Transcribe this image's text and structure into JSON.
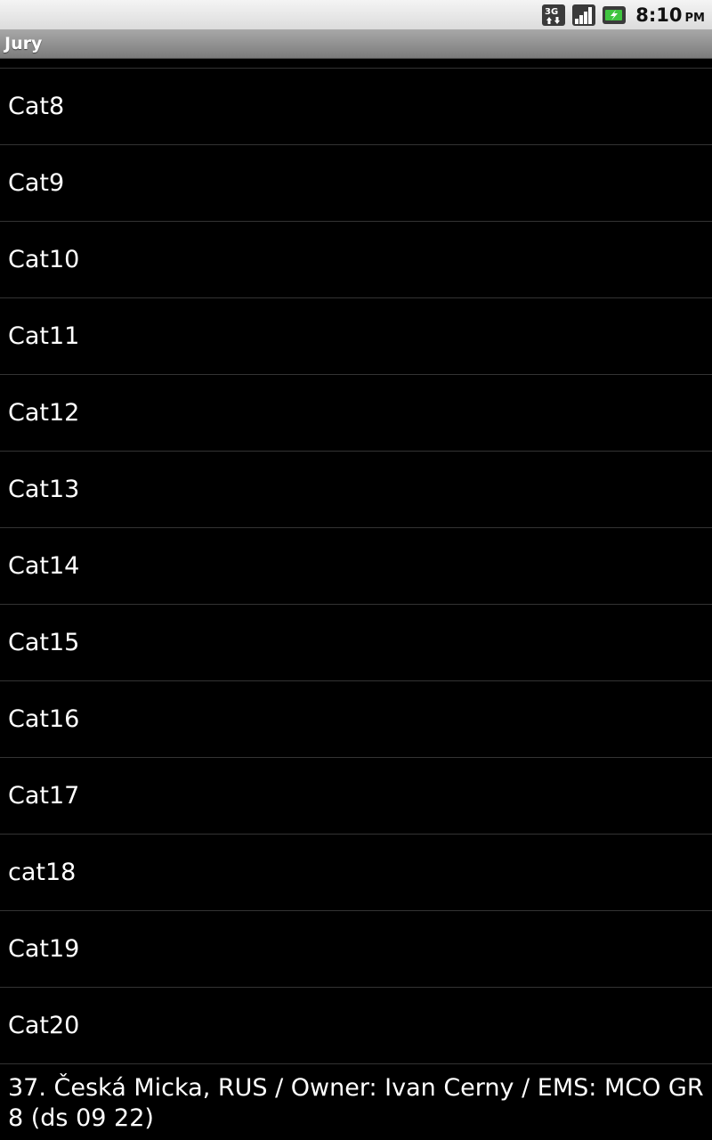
{
  "status_bar": {
    "time": "8:10",
    "ampm": "PM",
    "icons": [
      "3g-data-icon",
      "signal-strength-icon",
      "battery-charging-icon"
    ]
  },
  "title_bar": {
    "title": "Jury"
  },
  "list": {
    "items": [
      {
        "label": "Cat8"
      },
      {
        "label": "Cat9"
      },
      {
        "label": "Cat10"
      },
      {
        "label": "Cat11"
      },
      {
        "label": "Cat12"
      },
      {
        "label": "Cat13"
      },
      {
        "label": "Cat14"
      },
      {
        "label": "Cat15"
      },
      {
        "label": "Cat16"
      },
      {
        "label": "Cat17"
      },
      {
        "label": "cat18"
      },
      {
        "label": "Cat19"
      },
      {
        "label": "Cat20"
      }
    ]
  },
  "footer": {
    "text": "37. Česká Micka, RUS / Owner: Ivan Cerny / EMS: MCO GR  8 (ds 09 22)"
  },
  "colors": {
    "background": "#000000",
    "text": "#ffffff",
    "divider": "#333333",
    "title_bar": "#8c8c8c"
  }
}
